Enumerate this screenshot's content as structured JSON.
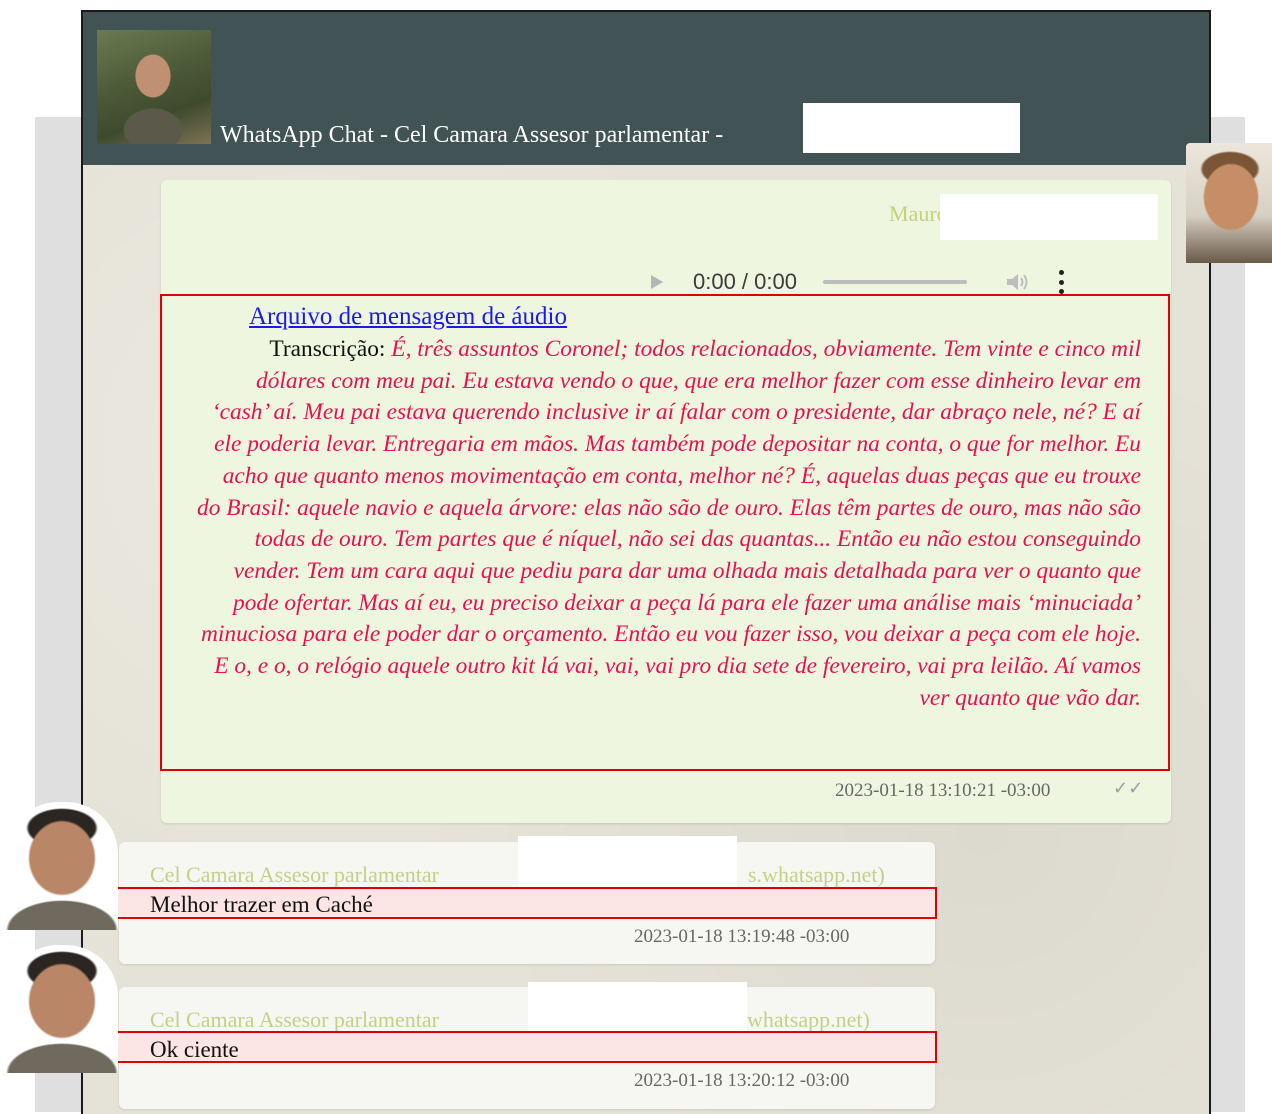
{
  "header": {
    "title": "WhatsApp Chat - Cel Camara Assesor parlamentar -"
  },
  "outgoing_message": {
    "sender": "Mauro Cid",
    "audio_player": {
      "time": "0:00 / 0:00"
    },
    "audio_link_text": "Arquivo de mensagem de áudio",
    "transcript_label": "Transcrição: ",
    "transcript_text": "É, três assuntos Coronel; todos relacionados, obviamente. Tem vinte e cinco mil dólares com meu pai. Eu estava vendo o que, que era melhor fazer com esse dinheiro levar em ‘cash’ aí. Meu pai estava querendo inclusive ir aí falar com o presidente, dar abraço nele, né? E aí ele poderia levar. Entregaria em mãos. Mas também pode depositar na conta, o que for melhor. Eu acho que quanto menos movimentação em conta, melhor né? É, aquelas duas peças que eu trouxe do Brasil: aquele navio e aquela árvore: elas não são de ouro. Elas têm partes de ouro, mas não são todas de ouro. Tem partes que é níquel, não sei das quantas... Então eu não estou conseguindo vender. Tem um cara aqui que pediu para dar uma olhada mais detalhada para ver o quanto que pode ofertar. Mas aí eu, eu preciso deixar a peça lá para ele fazer uma análise mais ‘minuciada’ minuciosa para ele poder dar o orçamento. Então eu vou fazer isso, vou deixar a peça com ele hoje. E o, e o, o relógio aquele outro kit lá vai, vai, vai pro dia sete de fevereiro, vai pra leilão. Aí vamos ver quanto que vão dar.",
    "timestamp": "2023-01-18 13:10:21 -03:00",
    "status_icon": "double-check-icon"
  },
  "incoming_messages": [
    {
      "sender": "Cel Camara Assesor parlamentar",
      "sender_suffix": "s.whatsapp.net)",
      "text": "Melhor trazer em Caché",
      "timestamp": "2023-01-18 13:19:48 -03:00"
    },
    {
      "sender": "Cel Camara Assesor parlamentar",
      "sender_suffix": "whatsapp.net)",
      "text": "Ok ciente",
      "timestamp": "2023-01-18 13:20:12 -03:00"
    }
  ],
  "colors": {
    "header_bg": "#415354",
    "outgoing_bubble": "#eef6df",
    "incoming_bubble": "#f6f6f3",
    "highlight_border": "#e00000",
    "transcript_text": "#e81050",
    "link": "#1a1aee",
    "sender_name": "#c7cf86"
  }
}
